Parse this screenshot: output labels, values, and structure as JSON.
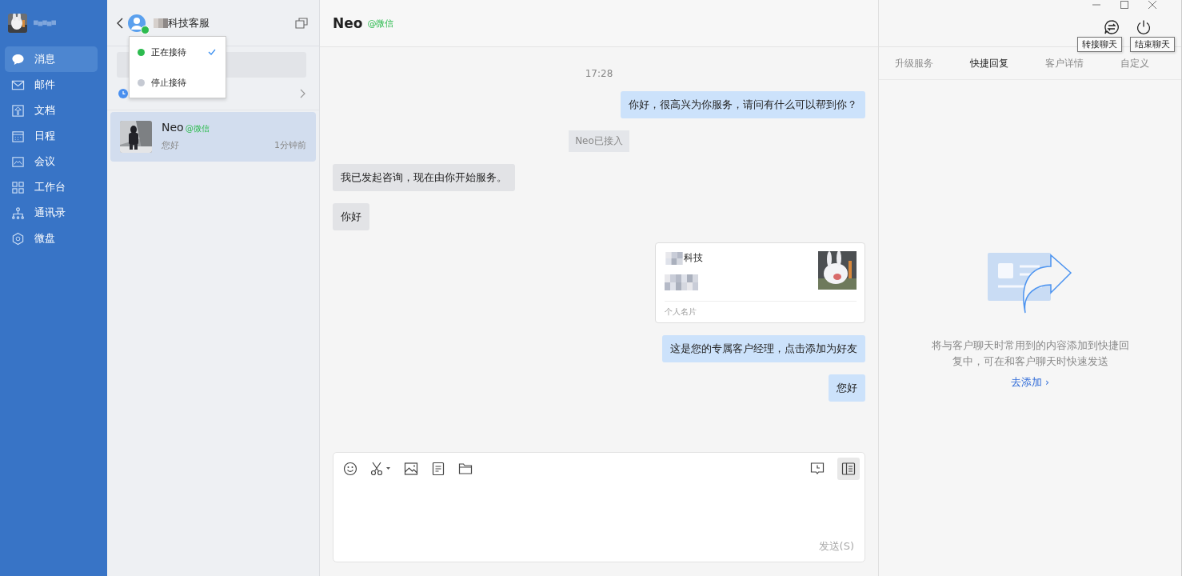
{
  "nav": [
    {
      "label": "消息",
      "selected": true
    },
    {
      "label": "邮件",
      "selected": false
    },
    {
      "label": "文档",
      "selected": false
    },
    {
      "label": "日程",
      "selected": false
    },
    {
      "label": "会议",
      "selected": false
    },
    {
      "label": "工作台",
      "selected": false
    },
    {
      "label": "通讯录",
      "selected": false
    },
    {
      "label": "微盘",
      "selected": false
    }
  ],
  "service": {
    "title": "科技客服",
    "online": true
  },
  "status_menu": [
    {
      "label": "正在接待",
      "color": "#2dbb4f",
      "selected": true
    },
    {
      "label": "停止接待",
      "color": "#c6cad3",
      "selected": false
    }
  ],
  "conversations": [
    {
      "name": "Neo",
      "source": "@微信",
      "preview": "您好",
      "time": "1分钟前",
      "selected": true
    }
  ],
  "chat": {
    "name": "Neo",
    "source": "@微信"
  },
  "messages": [
    {
      "kind": "time",
      "text": "17:28"
    },
    {
      "kind": "sent",
      "text": "你好，很高兴为你服务，请问有什么可以帮到你？"
    },
    {
      "kind": "system",
      "text": "Neo已接入"
    },
    {
      "kind": "received",
      "text": "我已发起咨询，现在由你开始服务。"
    },
    {
      "kind": "received",
      "text": "你好"
    },
    {
      "kind": "card",
      "title": "科技",
      "footer": "个人名片"
    },
    {
      "kind": "sent",
      "text": "这是您的专属客户经理，点击添加为好友"
    },
    {
      "kind": "sent",
      "text": "您好"
    }
  ],
  "composer": {
    "send": "发送(S)"
  },
  "tooltips": [
    "转接聊天",
    "结束聊天"
  ],
  "tabs": [
    {
      "label": "升级服务",
      "selected": false
    },
    {
      "label": "快捷回复",
      "selected": true
    },
    {
      "label": "客户详情",
      "selected": false
    },
    {
      "label": "自定义",
      "selected": false
    }
  ],
  "quick_reply": {
    "hint": "将与客户聊天时常用到的内容添加到快捷回复中，可在和客户聊天时快速发送",
    "link": "去添加 ›"
  }
}
